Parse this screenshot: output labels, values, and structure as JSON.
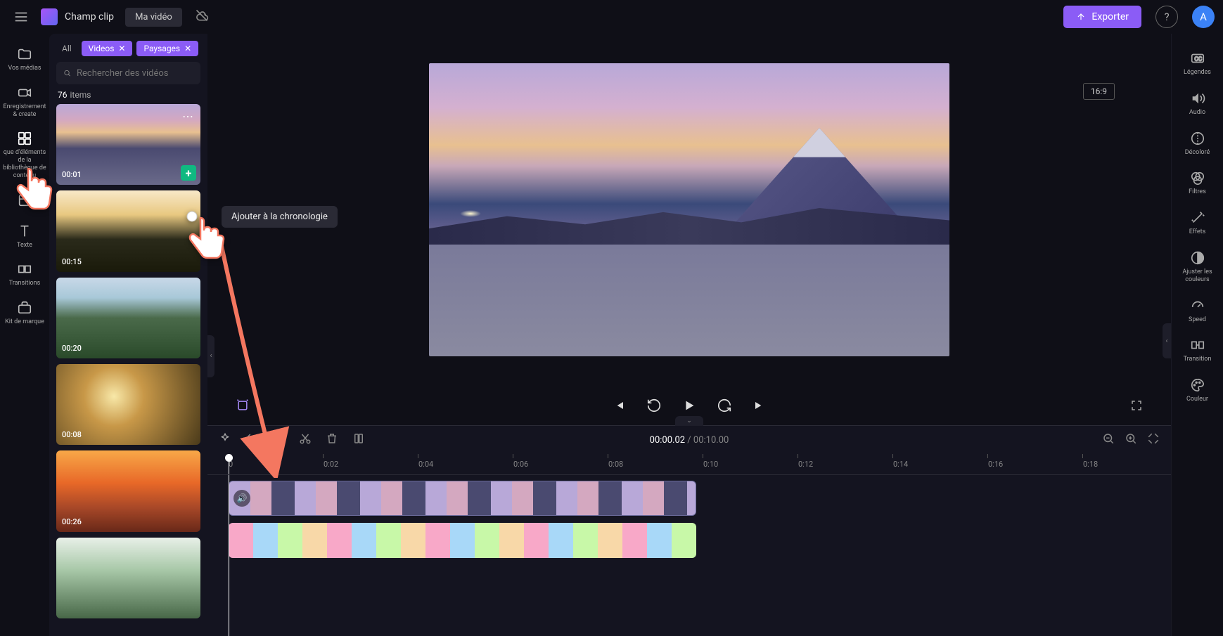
{
  "header": {
    "app_name": "Champ clip",
    "project_name": "Ma vidéo",
    "export_label": "Exporter",
    "avatar_initial": "A"
  },
  "left_rail": [
    {
      "id": "media",
      "label": "Vos médias"
    },
    {
      "id": "record",
      "label": "Enregistrement &\ncreate"
    },
    {
      "id": "library",
      "label": "que d'éléments de la bibliothèque de contenu"
    },
    {
      "id": "templates",
      "label": ""
    },
    {
      "id": "text",
      "label": "Texte"
    },
    {
      "id": "transitions",
      "label": "Transitions"
    },
    {
      "id": "brand",
      "label": "Kit de marque"
    }
  ],
  "media_panel": {
    "filter_all": "All",
    "filter_videos": "Videos",
    "filter_paysages": "Paysages",
    "search_placeholder": "Rechercher des vidéos",
    "count_number": "76",
    "count_label": "items",
    "tooltip_add": "Ajouter à la chronologie",
    "items": [
      {
        "duration": "00:01"
      },
      {
        "duration": "00:15"
      },
      {
        "duration": "00:20"
      },
      {
        "duration": "00:08"
      },
      {
        "duration": "00:26"
      },
      {
        "duration": ""
      }
    ]
  },
  "preview": {
    "aspect_ratio": "16:9"
  },
  "timeline": {
    "current": "00:00.02",
    "separator": " / ",
    "total": "00:10.00",
    "ticks": [
      "0",
      "0:02",
      "0:04",
      "0:06",
      "0:08",
      "0:10",
      "0:12",
      "0:14",
      "0:16",
      "0:18"
    ]
  },
  "right_rail": [
    {
      "id": "captions",
      "label": "Légendes"
    },
    {
      "id": "audio",
      "label": "Audio"
    },
    {
      "id": "fade",
      "label": "Décoloré"
    },
    {
      "id": "filters",
      "label": "Filtres"
    },
    {
      "id": "effects",
      "label": "Effets"
    },
    {
      "id": "adjust",
      "label": "Ajuster\nles couleurs"
    },
    {
      "id": "speed",
      "label": "Speed"
    },
    {
      "id": "transition",
      "label": "Transition"
    },
    {
      "id": "color",
      "label": "Couleur"
    }
  ]
}
